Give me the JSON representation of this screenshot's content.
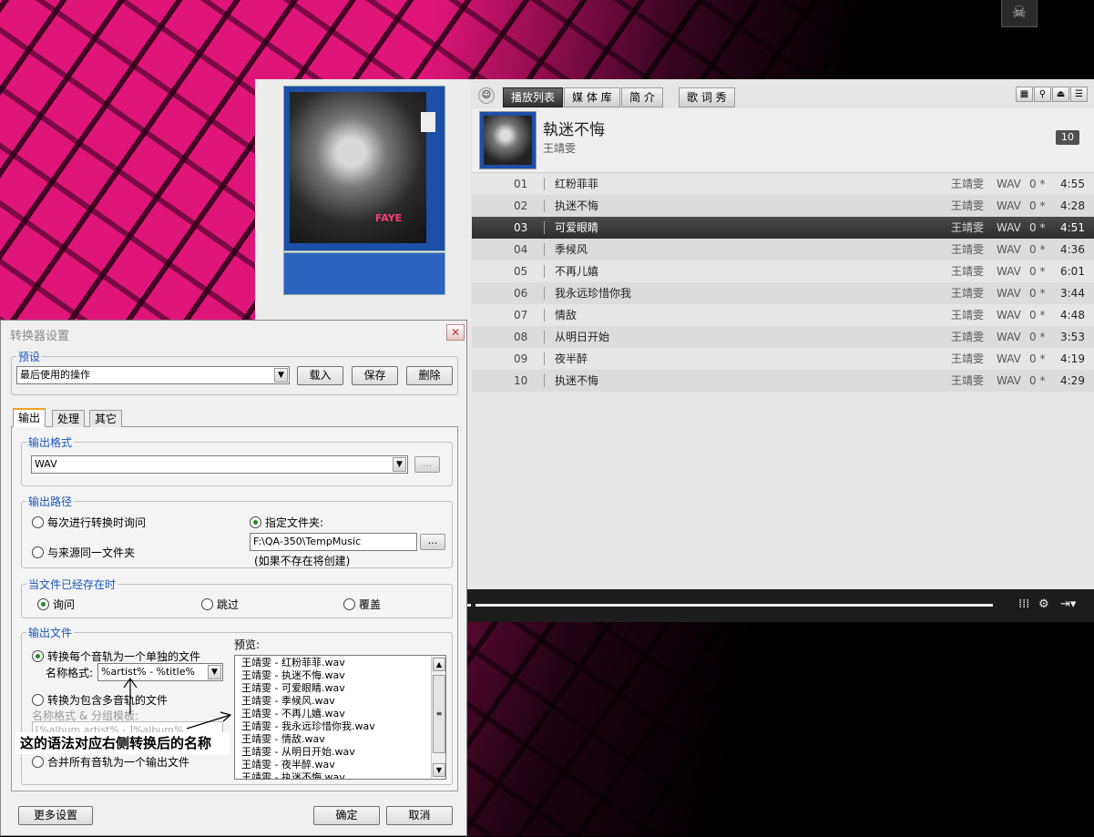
{
  "player": {
    "tabs": [
      {
        "label": "播放列表",
        "active": true
      },
      {
        "label": "媒 体 库",
        "active": false
      },
      {
        "label": "简   介",
        "active": false
      },
      {
        "label": "歌 词 秀",
        "active": false
      }
    ],
    "album": {
      "title": "執迷不悔",
      "artist": "王靖雯",
      "track_count": "10"
    },
    "tracks": [
      {
        "num": "01",
        "title": "红粉菲菲",
        "artist": "王靖雯",
        "format": "WAV",
        "rating": "0 *",
        "duration": "4:55"
      },
      {
        "num": "02",
        "title": "执迷不悔",
        "artist": "王靖雯",
        "format": "WAV",
        "rating": "0 *",
        "duration": "4:28"
      },
      {
        "num": "03",
        "title": "可爱眼睛",
        "artist": "王靖雯",
        "format": "WAV",
        "rating": "0 *",
        "duration": "4:51"
      },
      {
        "num": "04",
        "title": "季候风",
        "artist": "王靖雯",
        "format": "WAV",
        "rating": "0 *",
        "duration": "4:36"
      },
      {
        "num": "05",
        "title": "不再儿嬉",
        "artist": "王靖雯",
        "format": "WAV",
        "rating": "0 *",
        "duration": "6:01"
      },
      {
        "num": "06",
        "title": "我永远珍惜你我",
        "artist": "王靖雯",
        "format": "WAV",
        "rating": "0 *",
        "duration": "3:44"
      },
      {
        "num": "07",
        "title": "情敌",
        "artist": "王靖雯",
        "format": "WAV",
        "rating": "0 *",
        "duration": "4:48"
      },
      {
        "num": "08",
        "title": "从明日开始",
        "artist": "王靖雯",
        "format": "WAV",
        "rating": "0 *",
        "duration": "3:53"
      },
      {
        "num": "09",
        "title": "夜半醉",
        "artist": "王靖雯",
        "format": "WAV",
        "rating": "0 *",
        "duration": "4:19"
      },
      {
        "num": "10",
        "title": "执迷不悔",
        "artist": "王靖雯",
        "format": "WAV",
        "rating": "0 *",
        "duration": "4:29"
      }
    ],
    "selected_track_index": 2,
    "cover_tag": "FAYE"
  },
  "dialog": {
    "title": "转换器设置",
    "preset": {
      "legend": "预设",
      "value": "最后使用的操作",
      "load_label": "载入",
      "save_label": "保存",
      "delete_label": "删除"
    },
    "tabs": [
      {
        "label": "输出",
        "active": true
      },
      {
        "label": "处理",
        "active": false
      },
      {
        "label": "其它",
        "active": false
      }
    ],
    "output_format": {
      "legend": "输出格式",
      "value": "WAV",
      "more_label": "..."
    },
    "output_path": {
      "legend": "输出路径",
      "ask_label": "每次进行转换时询问",
      "same_source_label": "与来源同一文件夹",
      "specify_label": "指定文件夹:",
      "folder_value": "F:\\QA-350\\TempMusic",
      "browse_label": "...",
      "note": "(如果不存在将创建)"
    },
    "file_exists": {
      "legend": "当文件已经存在时",
      "ask_label": "询问",
      "skip_label": "跳过",
      "overwrite_label": "覆盖"
    },
    "output_file": {
      "legend": "输出文件",
      "each_track_label": "转换每个音轨为一个单独的文件",
      "name_format_label": "名称格式:",
      "name_format_value": "%artist% - %title%",
      "multi_track_label": "转换为包含多音轨的文件",
      "group_template_label": "名称格式 & 分组模板:",
      "group_template_value": "[%album artist% - ]%album%",
      "merge_label": "合并所有音轨为一个输出文件",
      "preview_label": "预览:",
      "preview_lines": [
        "王靖雯 - 红粉菲菲.wav",
        "王靖雯 - 执迷不悔.wav",
        "王靖雯 - 可爱眼睛.wav",
        "王靖雯 - 季候风.wav",
        "王靖雯 - 不再儿嬉.wav",
        "王靖雯 - 我永远珍惜你我.wav",
        "王靖雯 - 情敌.wav",
        "王靖雯 - 从明日开始.wav",
        "王靖雯 - 夜半醉.wav",
        "王靖雯 - 执迷不悔.wav"
      ]
    },
    "annotation": "这的语法对应右侧转换后的名称",
    "more_settings_label": "更多设置",
    "ok_label": "确定",
    "cancel_label": "取消"
  }
}
